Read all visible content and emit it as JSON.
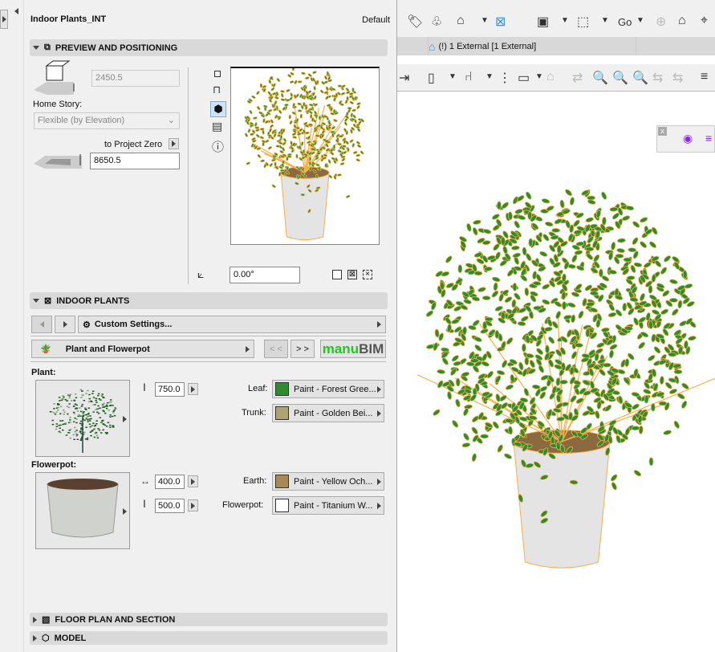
{
  "panel": {
    "title": "Indoor Plants_INT",
    "preset": "Default",
    "preview_section": "PREVIEW AND POSITIONING",
    "height_value": "2450.5",
    "home_story_label": "Home Story:",
    "home_story_value": "Flexible (by Elevation)",
    "ref_label": "to Project Zero",
    "elevation_value": "8650.5",
    "angle_value": "0.00°",
    "plants_section": "INDOOR PLANTS",
    "custom_settings": "Custom Settings...",
    "page_label": "Plant and Flowerpot",
    "prev_label": "< <",
    "next_label": "> >",
    "brand_a": "manu",
    "brand_b": "BIM",
    "plant_label": "Plant:",
    "plant_height": "750.0",
    "leaf_label": "Leaf:",
    "leaf_paint": "Paint - Forest Gree...",
    "trunk_label": "Trunk:",
    "trunk_paint": "Paint - Golden Bei...",
    "flowerpot_label": "Flowerpot:",
    "pot_width": "400.0",
    "pot_height": "500.0",
    "earth_label": "Earth:",
    "earth_paint": "Paint - Yellow Och...",
    "pot_paint_label": "Flowerpot:",
    "pot_paint": "Paint - Titanium W...",
    "floor_section": "FLOOR PLAN AND SECTION",
    "model_section": "MODEL"
  },
  "colors": {
    "leaf": "#2e8b2e",
    "trunk": "#ada373",
    "earth": "#a88a58",
    "pot": "#ffffff",
    "brand_green": "#1ec81e",
    "highlight": "#f5b04a"
  },
  "toolbar": {
    "go_label": "Go",
    "story_tab": "(!) 1 External [1 External]"
  }
}
